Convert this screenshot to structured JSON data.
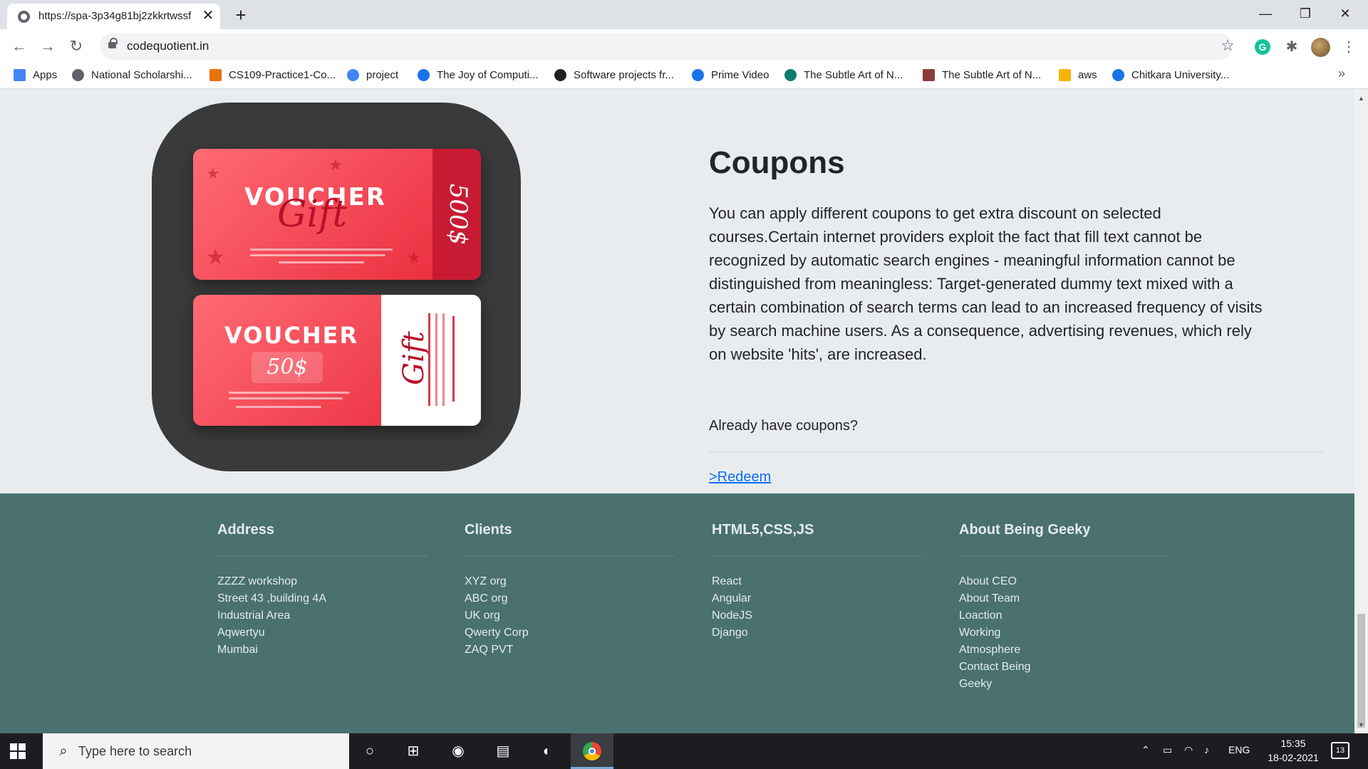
{
  "browser": {
    "tab": {
      "title": "https://spa-3p34g81bj2zkkrtwssf",
      "close": "✕"
    },
    "new_tab": "+",
    "window_controls": {
      "minimize": "—",
      "restore": "❐",
      "close": "✕"
    },
    "nav": {
      "back": "←",
      "forward": "→",
      "reload": "↻"
    },
    "url": "codequotient.in",
    "bookmark_star": "☆",
    "extension_letter": "G",
    "extensions_icon": "✱",
    "menu": "⋮",
    "bookmarks": [
      {
        "label": "Apps",
        "icon": "apps-grid-icon",
        "color": "#4285f4"
      },
      {
        "label": "National Scholarshi...",
        "icon": "globe-icon",
        "color": "#5f6368"
      },
      {
        "label": "CS109-Practice1-Co...",
        "icon": "cq-icon",
        "color": "#e8710a"
      },
      {
        "label": "project",
        "icon": "google-icon",
        "color": "#4285f4"
      },
      {
        "label": "The Joy of Computi...",
        "icon": "swayam-icon",
        "color": "#1a73e8"
      },
      {
        "label": "Software projects fr...",
        "icon": "d-icon",
        "color": "#202124"
      },
      {
        "label": "Prime Video",
        "icon": "play-icon",
        "color": "#1a73e8"
      },
      {
        "label": "The Subtle Art of N...",
        "icon": "globe-icon",
        "color": "#0f7b6c"
      },
      {
        "label": "The Subtle Art of N...",
        "icon": "cat-icon",
        "color": "#8a3b3b"
      },
      {
        "label": "aws",
        "icon": "box-icon",
        "color": "#f5b400"
      },
      {
        "label": "Chitkara University...",
        "icon": "c-icon",
        "color": "#1a73e8"
      }
    ],
    "bookmarks_more": "»"
  },
  "voucher_image": {
    "top": {
      "word": "VOUCHER",
      "script": "Gift",
      "amount": "500$"
    },
    "bottom": {
      "word": "VOUCHER",
      "amount": "50$",
      "script": "Gift"
    }
  },
  "coupons": {
    "title": "Coupons",
    "body": "You can apply different coupons to get extra discount on selected courses.Certain internet providers exploit the fact that fill text cannot be recognized by automatic search engines - meaningful information cannot be distinguished from meaningless: Target-generated dummy text mixed with a certain combination of search terms can lead to an increased frequency of visits by search machine users. As a consequence, advertising revenues, which rely on website 'hits', are increased.",
    "prompt": "Already have coupons?",
    "redeem_link": ">Redeem"
  },
  "footer": {
    "columns": [
      {
        "heading": "Address",
        "items": [
          "ZZZZ workshop",
          "Street 43 ,building 4A",
          "Industrial Area",
          "Aqwertyu",
          "Mumbai"
        ]
      },
      {
        "heading": "Clients",
        "items": [
          "XYZ org",
          "ABC org",
          "UK org",
          "Qwerty Corp",
          "ZAQ PVT"
        ]
      },
      {
        "heading": "HTML5,CSS,JS",
        "items": [
          "React",
          "Angular",
          "NodeJS",
          "Django"
        ]
      },
      {
        "heading": "About Being Geeky",
        "items": [
          "About CEO",
          "About Team",
          "Loaction",
          "Working",
          "Atmosphere",
          "Contact Being",
          "Geeky"
        ]
      }
    ]
  },
  "taskbar": {
    "search_placeholder": "Type here to search",
    "language": "ENG",
    "time": "15:35",
    "date": "18-02-2021",
    "notifications": "13"
  },
  "colors": {
    "page_bg": "#e9ecef",
    "footer_bg": "#4a7070",
    "link": "#0d6efd",
    "voucher_red": "#e8283a"
  }
}
